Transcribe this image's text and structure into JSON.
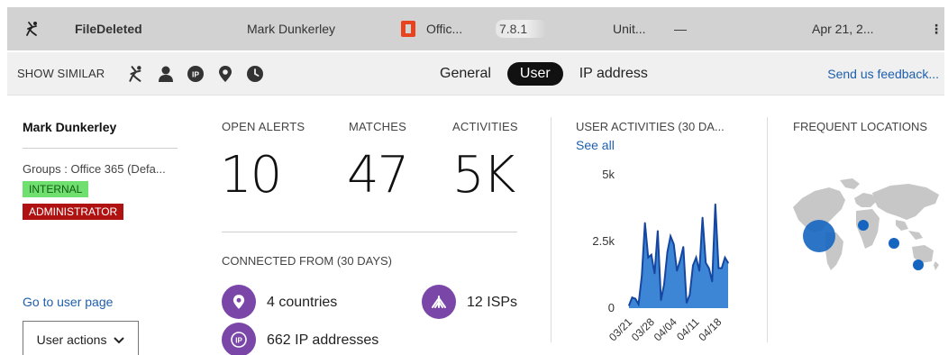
{
  "alert_row": {
    "title": "FileDeleted",
    "user": "Mark Dunkerley",
    "app": "Offic...",
    "ip": "7.8.1",
    "location": "Unit...",
    "dash": "—",
    "date": "Apr 21, 2..."
  },
  "similar_bar": {
    "label": "SHOW SIMILAR",
    "icons": [
      "activity-icon",
      "user-icon",
      "ip-icon",
      "location-pin-icon",
      "clock-icon"
    ],
    "tabs": [
      {
        "label": "General",
        "active": false
      },
      {
        "label": "User",
        "active": true
      },
      {
        "label": "IP address",
        "active": false
      }
    ],
    "feedback": "Send us feedback..."
  },
  "user_panel": {
    "name": "Mark Dunkerley",
    "groups": "Groups : Office 365 (Defa...",
    "tags": [
      "INTERNAL",
      "ADMINISTRATOR"
    ],
    "goto": "Go to user page",
    "actions": "User actions"
  },
  "stats": {
    "open_alerts": {
      "label": "OPEN ALERTS",
      "value": "10"
    },
    "matches": {
      "label": "MATCHES",
      "value": "47"
    },
    "activities": {
      "label": "ACTIVITIES",
      "value": "5K"
    }
  },
  "connected": {
    "label": "CONNECTED FROM (30 DAYS)",
    "countries": "4 countries",
    "isps": "12 ISPs",
    "ips": "662 IP addresses"
  },
  "activities_chart": {
    "title": "USER ACTIVITIES (30 DA...",
    "see_all": "See all"
  },
  "locations": {
    "title": "FREQUENT LOCATIONS"
  },
  "colors": {
    "accent_purple": "#7a47a8",
    "chart_fill": "#3d86d6",
    "chart_line": "#1546a0",
    "link": "#1f5fad",
    "internal_tag": "#6fe06f",
    "admin_tag": "#b01212"
  },
  "chart_data": {
    "type": "area",
    "title": "USER ACTIVITIES (30 DA...",
    "xlabel": "",
    "ylabel": "",
    "ylim": [
      0,
      5000
    ],
    "yticks": [
      "5k",
      "2.5k",
      "0"
    ],
    "xticks": [
      "03/21",
      "03/28",
      "04/04",
      "04/11",
      "04/18"
    ],
    "x": [
      "03/21",
      "03/22",
      "03/23",
      "03/24",
      "03/25",
      "03/26",
      "03/27",
      "03/28",
      "03/29",
      "03/30",
      "03/31",
      "04/01",
      "04/02",
      "04/03",
      "04/04",
      "04/05",
      "04/06",
      "04/07",
      "04/08",
      "04/09",
      "04/10",
      "04/11",
      "04/12",
      "04/13",
      "04/14",
      "04/15",
      "04/16",
      "04/17",
      "04/18",
      "04/19",
      "04/20",
      "04/21"
    ],
    "values": [
      100,
      400,
      350,
      150,
      1200,
      3200,
      1900,
      2000,
      1300,
      2900,
      300,
      900,
      2100,
      2700,
      2400,
      1400,
      1800,
      2300,
      200,
      500,
      1600,
      1900,
      1400,
      3400,
      1700,
      1500,
      1000,
      3900,
      1500,
      1500,
      1900,
      1700
    ]
  }
}
